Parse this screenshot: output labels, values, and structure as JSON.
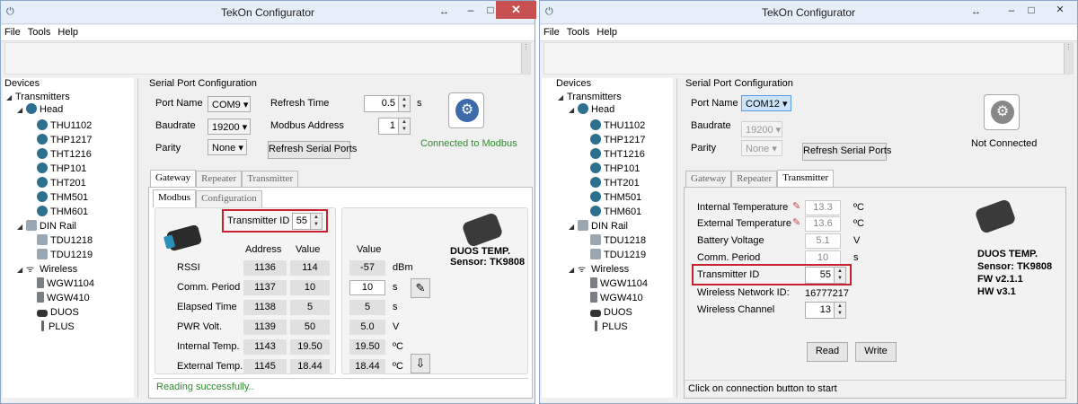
{
  "win1": {
    "title": "TekOn Configurator",
    "menu": [
      "File",
      "Tools",
      "Help"
    ],
    "tree": {
      "header": "Devices",
      "nodes": [
        "Transmitters",
        "Head",
        "THU1102",
        "THP1217",
        "THT1216",
        "THP101",
        "THT201",
        "THM501",
        "THM601",
        "DIN Rail",
        "TDU1218",
        "TDU1219",
        "Wireless",
        "WGW1104",
        "WGW410",
        "DUOS",
        "PLUS"
      ]
    },
    "serial": {
      "group": "Serial Port Configuration",
      "port_label": "Port Name",
      "port": "COM9 ▾",
      "baud_label": "Baudrate",
      "baud": "19200 ▾",
      "parity_label": "Parity",
      "parity": "None ▾",
      "refresh_label": "Refresh Time",
      "refresh": "0.5",
      "refresh_unit": "s",
      "modbus_label": "Modbus Address",
      "modbus": "1",
      "refresh_ports": "Refresh Serial Ports",
      "status": "Connected to Modbus"
    },
    "tabs": [
      "Gateway",
      "Repeater",
      "Transmitter"
    ],
    "subtabs": [
      "Modbus",
      "Configuration"
    ],
    "tx_label": "Transmitter ID",
    "tx_value": "55",
    "headers": {
      "address": "Address",
      "value": "Value",
      "value2": "Value"
    },
    "rows": [
      {
        "name": "RSSI",
        "addr": "1136",
        "val": "114",
        "val2": "-57",
        "unit": "dBm"
      },
      {
        "name": "Comm. Period",
        "addr": "1137",
        "val": "10",
        "val2": "10",
        "unit": "s"
      },
      {
        "name": "Elapsed Time",
        "addr": "1138",
        "val": "5",
        "val2": "5",
        "unit": "s"
      },
      {
        "name": "PWR Volt.",
        "addr": "1139",
        "val": "50",
        "val2": "5.0",
        "unit": "V"
      },
      {
        "name": "Internal Temp.",
        "addr": "1143",
        "val": "19.50",
        "val2": "19.50",
        "unit": "ºC"
      },
      {
        "name": "External Temp.",
        "addr": "1145",
        "val": "18.44",
        "val2": "18.44",
        "unit": "ºC"
      }
    ],
    "device_name": "DUOS TEMP.",
    "device_sensor": "Sensor: TK9808",
    "status_msg": "Reading successfully..",
    "status_color": "#2e8b2e"
  },
  "win2": {
    "title": "TekOn Configurator",
    "menu": [
      "File",
      "Tools",
      "Help"
    ],
    "tree": {
      "header": "Devices",
      "nodes": [
        "Transmitters",
        "Head",
        "THU1102",
        "THP1217",
        "THT1216",
        "THP101",
        "THT201",
        "THM501",
        "THM601",
        "DIN Rail",
        "TDU1218",
        "TDU1219",
        "Wireless",
        "WGW1104",
        "WGW410",
        "DUOS",
        "PLUS"
      ]
    },
    "serial": {
      "group": "Serial Port Configuration",
      "port_label": "Port Name",
      "port": "COM12 ▾",
      "baud_label": "Baudrate",
      "baud": "19200 ▾",
      "parity_label": "Parity",
      "parity": "None ▾",
      "refresh_ports": "Refresh Serial Ports",
      "status": "Not Connected"
    },
    "tabs": [
      "Gateway",
      "Repeater",
      "Transmitter"
    ],
    "fields": [
      {
        "label": "Internal Temperature",
        "value": "13.3",
        "unit": "ºC"
      },
      {
        "label": "External Temperature",
        "value": "13.6",
        "unit": "ºC"
      },
      {
        "label": "Battery Voltage",
        "value": "5.1",
        "unit": "V"
      },
      {
        "label": "Comm. Period",
        "value": "10",
        "unit": "s"
      }
    ],
    "tx_label": "Transmitter ID",
    "tx_value": "55",
    "wnet_label": "Wireless Network ID:",
    "wnet_value": "16777217",
    "wch_label": "Wireless Channel",
    "wch_value": "13",
    "device_name": "DUOS TEMP.",
    "device_sensor": "Sensor: TK9808",
    "device_fw": "FW v2.1.1",
    "device_hw": "HW v3.1",
    "read_label": "Read",
    "write_label": "Write",
    "status_msg": "Click on connection button to start"
  },
  "icons": {
    "app": "settings-app-icon",
    "conn": "connection-icon",
    "write": "write-icon"
  }
}
